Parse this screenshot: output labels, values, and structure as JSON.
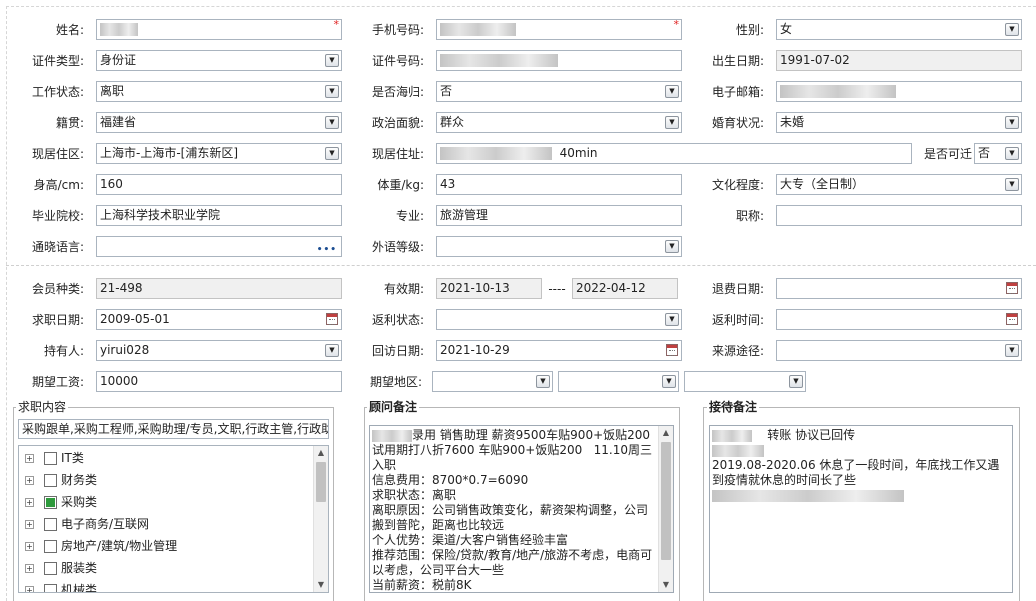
{
  "row1": {
    "name_label": "姓名:",
    "phone_label": "手机号码:",
    "gender_label": "性别:",
    "gender_value": "女",
    "required_mark": "*"
  },
  "row2": {
    "id_type_label": "证件类型:",
    "id_type_value": "身份证",
    "id_no_label": "证件号码:",
    "birth_label": "出生日期:",
    "birth_value": "1991-07-02"
  },
  "row3": {
    "work_status_label": "工作状态:",
    "work_status_value": "离职",
    "returnee_label": "是否海归:",
    "returnee_value": "否",
    "email_label": "电子邮箱:"
  },
  "row4": {
    "native_label": "籍贯:",
    "native_value": "福建省",
    "political_label": "政治面貌:",
    "political_value": "群众",
    "marital_label": "婚育状况:",
    "marital_value": "未婚"
  },
  "row5": {
    "area_label": "现居住区:",
    "area_value": "上海市-上海市-[浦东新区]",
    "address_label": "现居住址:",
    "address_suffix": "40min",
    "relocate_label": "是否可迁",
    "relocate_value": "否"
  },
  "row6": {
    "height_label": "身高/cm:",
    "height_value": "160",
    "weight_label": "体重/kg:",
    "weight_value": "43",
    "education_label": "文化程度:",
    "education_value": "大专（全日制）"
  },
  "row7": {
    "school_label": "毕业院校:",
    "school_value": "上海科学技术职业学院",
    "major_label": "专业:",
    "major_value": "旅游管理",
    "title_label": "职称:",
    "title_value": ""
  },
  "row8": {
    "language_label": "通晓语言:",
    "language_more": "•••",
    "foreign_label": "外语等级:"
  },
  "row9": {
    "member_label": "会员种类:",
    "member_value": "21-498",
    "valid_label": "有效期:",
    "valid_from": "2021-10-13",
    "valid_sep": "----",
    "valid_to": "2022-04-12",
    "refund_label": "退费日期:"
  },
  "row10": {
    "job_date_label": "求职日期:",
    "job_date_value": "2009-05-01",
    "rebate_status_label": "返利状态:",
    "rebate_time_label": "返利时间:"
  },
  "row11": {
    "holder_label": "持有人:",
    "holder_value": "yirui028",
    "visit_label": "回访日期:",
    "visit_value": "2021-10-29",
    "source_label": "来源途径:"
  },
  "row12": {
    "salary_label": "期望工资:",
    "salary_value": "10000",
    "region_label": "期望地区:"
  },
  "job_content": {
    "title": "求职内容",
    "summary": "采购跟单,采购工程师,采购助理/专员,文职,行政主管,行政助理",
    "categories": [
      {
        "label": "IT类",
        "checked": false
      },
      {
        "label": "财务类",
        "checked": false
      },
      {
        "label": "采购类",
        "checked": true
      },
      {
        "label": "电子商务/互联网",
        "checked": false
      },
      {
        "label": "房地产/建筑/物业管理",
        "checked": false
      },
      {
        "label": "服装类",
        "checked": false
      },
      {
        "label": "机械类",
        "checked": false
      }
    ]
  },
  "consultant_notes": {
    "title": "顾问备注",
    "line1": "录用 销售助理 薪资9500车贴900+饭贴200",
    "body": "试用期打八折7600 车贴900+饭贴200   11.10周三入职\n信息费用：8700*0.7=6090\n求职状态：离职\n离职原因：公司销售政策变化，薪资架构调整，公司搬到普陀，距离也比较远\n个人优势：渠道/大客户销售经验丰富\n推荐范围：保险/贷款/教育/地产/旅游不考虑，电商可以考虑，公司平台大一些\n当前薪资：税前8K"
  },
  "reception_notes": {
    "title": "接待备注",
    "line1": "转账 协议已回传",
    "body": "2019.08-2020.06 休息了一段时间，年底找工作又遇到疫情就休息的时间长了些"
  }
}
